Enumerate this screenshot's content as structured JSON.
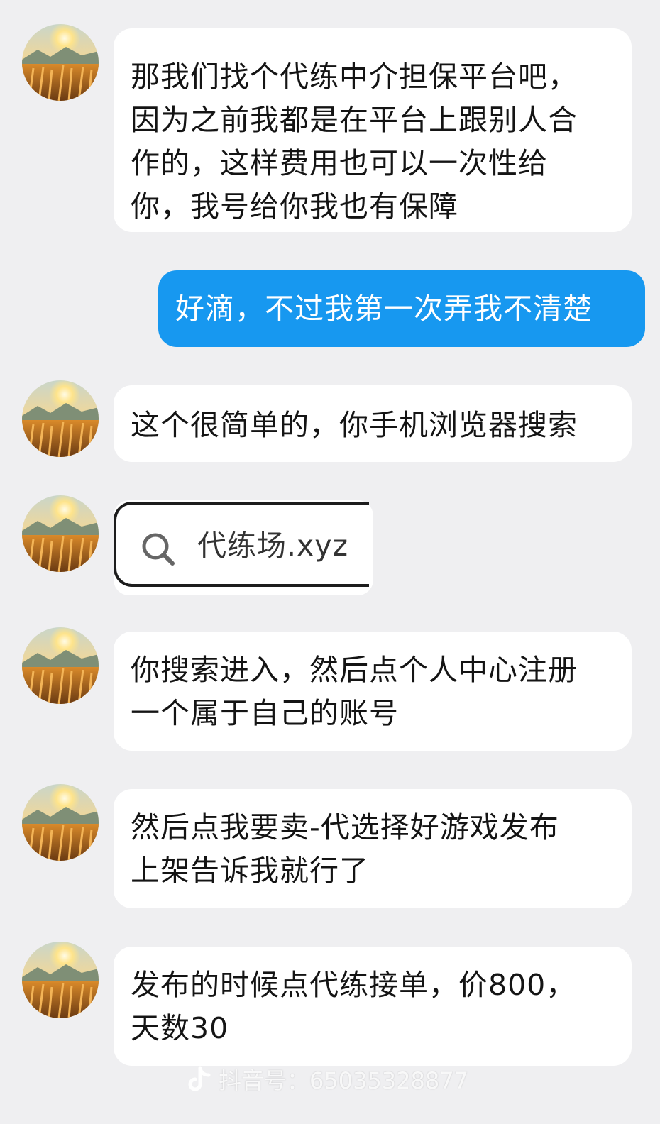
{
  "chat": {
    "messages": [
      {
        "id": "m1",
        "direction": "incoming",
        "lines": [
          "那我们找个代练中介担保平台吧，",
          "因为之前我都是在平台上跟别人合",
          "作的，这样费用也可以一次性给",
          "你，我号给你我也有保障"
        ]
      },
      {
        "id": "m2",
        "direction": "outgoing",
        "lines": [
          "好滴，不过我第一次弄我不清楚"
        ]
      },
      {
        "id": "m3",
        "direction": "incoming",
        "lines": [
          "这个很简单的，你手机浏览器搜索"
        ]
      },
      {
        "id": "m4",
        "direction": "incoming",
        "type": "search-image",
        "search_text": "代练场.xyz",
        "icon": "search-icon"
      },
      {
        "id": "m5",
        "direction": "incoming",
        "lines": [
          "你搜索进入，然后点个人中心注册",
          "一个属于自己的账号"
        ]
      },
      {
        "id": "m6",
        "direction": "incoming",
        "lines": [
          "然后点我要卖-代选择好游戏发布",
          "上架告诉我就行了"
        ]
      },
      {
        "id": "m7",
        "direction": "incoming",
        "lines": [
          "发布的时候点代练接单，价800，",
          "天数30"
        ]
      }
    ]
  },
  "watermark": {
    "label": "抖音号：65035328877",
    "icon": "douyin-logo-icon"
  },
  "colors": {
    "background": "#efeff1",
    "incoming_bubble": "#ffffff",
    "outgoing_bubble": "#1798f0"
  }
}
